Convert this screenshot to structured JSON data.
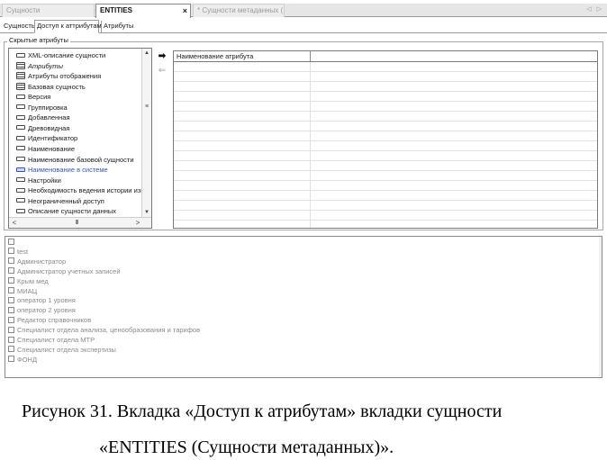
{
  "doc_tabs": [
    {
      "label": "Сущности",
      "active": false
    },
    {
      "label": "ENTITIES",
      "active": true,
      "close": "×"
    },
    {
      "label": "* Сущности метаданных (...",
      "active": false
    }
  ],
  "nav_arrows": "◁ ▷",
  "sub_tabs": [
    {
      "label": "Сущность",
      "active": false
    },
    {
      "label": "Доступ к аттрибутам",
      "active": true
    },
    {
      "label": "Атрибуты",
      "active": false
    }
  ],
  "hidden_group": {
    "caption": "Скрытые атрибуты"
  },
  "hidden_attributes": [
    {
      "label": "XML-описание сущности",
      "icon": "field-icon"
    },
    {
      "label": "Атрибуты",
      "icon": "table-icon",
      "italic": true
    },
    {
      "label": "Атрибуты отображения",
      "icon": "table-icon"
    },
    {
      "label": "Базовая сущность",
      "icon": "table-icon"
    },
    {
      "label": "Версия",
      "icon": "field-icon"
    },
    {
      "label": "Группировка",
      "icon": "field-icon"
    },
    {
      "label": "Добавленная",
      "icon": "field-icon"
    },
    {
      "label": "Древовидная",
      "icon": "field-icon"
    },
    {
      "label": "Идентификатор",
      "icon": "field-icon"
    },
    {
      "label": "Наименование",
      "icon": "field-icon"
    },
    {
      "label": "Наименование базовой сущности",
      "icon": "field-icon"
    },
    {
      "label": "Наименование в системе",
      "icon": "field-icon",
      "selected": true
    },
    {
      "label": "Настройки",
      "icon": "field-icon"
    },
    {
      "label": "Необходимость ведения истории изменений",
      "icon": "field-icon"
    },
    {
      "label": "Неограниченный доступ",
      "icon": "field-icon"
    },
    {
      "label": "Описание сущности данных",
      "icon": "field-icon"
    }
  ],
  "scroll": {
    "up": "▲",
    "down": "▼",
    "grip": "≡",
    "left": "<",
    "right": ">",
    "hgrip": "III"
  },
  "move_buttons": {
    "add": "➡",
    "remove": "⇐"
  },
  "grid": {
    "column_header": "Наименование атрибута"
  },
  "roles": [
    "",
    "test",
    "Администратор",
    "Администратор учетных записей",
    "Крым мед",
    "МИАЦ",
    "оператор 1 уровня",
    "оператор 2 уровня",
    "Редактор справочников",
    "Специалист отдела анализа, ценообразования и тарифов",
    "Специалист отдела МТР",
    "Специалист отдела экспертизы",
    "ФОНД"
  ],
  "caption": {
    "line1": "Рисунок 31. Вкладка «Доступ к атрибутам» вкладки сущности",
    "line2": "«ENTITIES (Сущности метаданных)»."
  }
}
